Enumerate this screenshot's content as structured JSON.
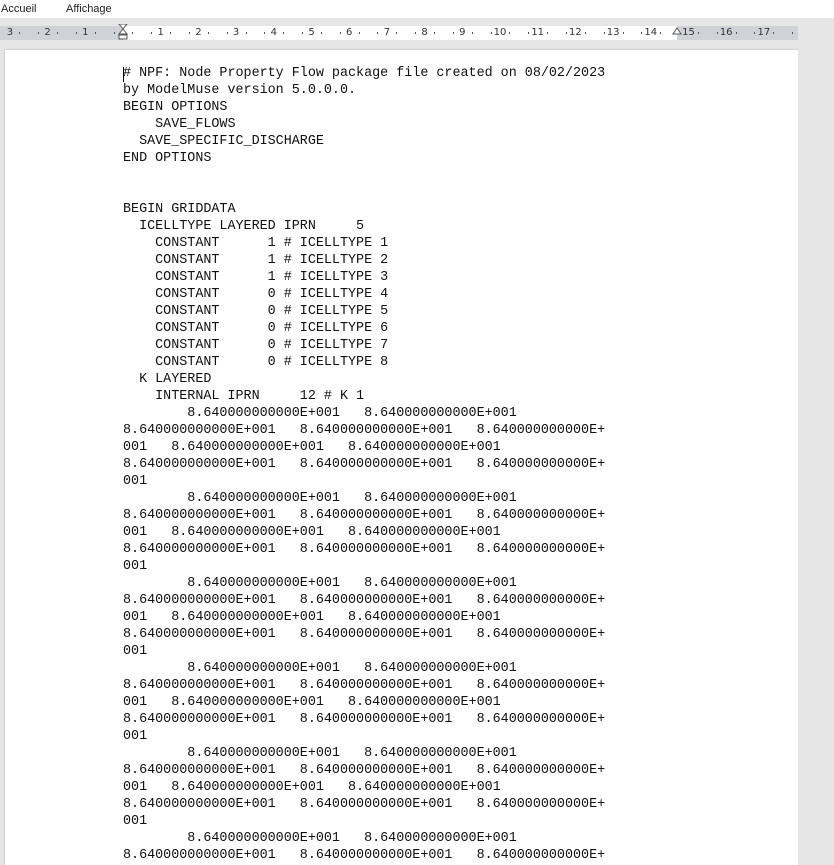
{
  "menu": {
    "tabs": [
      "Accueil",
      "Affichage"
    ]
  },
  "ruler": {
    "labels": [
      "3",
      "2",
      "1",
      "1",
      "2",
      "3",
      "4",
      "5",
      "6",
      "7",
      "8",
      "9",
      "10",
      "11",
      "12",
      "13",
      "14",
      "15",
      "16",
      "17"
    ]
  },
  "document": {
    "lines": [
      "# NPF: Node Property Flow package file created on 08/02/2023",
      "by ModelMuse version 5.0.0.0.",
      "BEGIN OPTIONS",
      "    SAVE_FLOWS",
      "  SAVE_SPECIFIC_DISCHARGE",
      "END OPTIONS",
      "",
      "",
      "BEGIN GRIDDATA",
      "  ICELLTYPE LAYERED IPRN     5",
      "    CONSTANT      1 # ICELLTYPE 1",
      "    CONSTANT      1 # ICELLTYPE 2",
      "    CONSTANT      1 # ICELLTYPE 3",
      "    CONSTANT      0 # ICELLTYPE 4",
      "    CONSTANT      0 # ICELLTYPE 5",
      "    CONSTANT      0 # ICELLTYPE 6",
      "    CONSTANT      0 # ICELLTYPE 7",
      "    CONSTANT      0 # ICELLTYPE 8",
      "  K LAYERED",
      "    INTERNAL IPRN     12 # K 1",
      "        8.640000000000E+001   8.640000000000E+001",
      "8.640000000000E+001   8.640000000000E+001   8.640000000000E+",
      "001   8.640000000000E+001   8.640000000000E+001",
      "8.640000000000E+001   8.640000000000E+001   8.640000000000E+",
      "001",
      "        8.640000000000E+001   8.640000000000E+001",
      "8.640000000000E+001   8.640000000000E+001   8.640000000000E+",
      "001   8.640000000000E+001   8.640000000000E+001",
      "8.640000000000E+001   8.640000000000E+001   8.640000000000E+",
      "001",
      "        8.640000000000E+001   8.640000000000E+001",
      "8.640000000000E+001   8.640000000000E+001   8.640000000000E+",
      "001   8.640000000000E+001   8.640000000000E+001",
      "8.640000000000E+001   8.640000000000E+001   8.640000000000E+",
      "001",
      "        8.640000000000E+001   8.640000000000E+001",
      "8.640000000000E+001   8.640000000000E+001   8.640000000000E+",
      "001   8.640000000000E+001   8.640000000000E+001",
      "8.640000000000E+001   8.640000000000E+001   8.640000000000E+",
      "001",
      "        8.640000000000E+001   8.640000000000E+001",
      "8.640000000000E+001   8.640000000000E+001   8.640000000000E+",
      "001   8.640000000000E+001   8.640000000000E+001",
      "8.640000000000E+001   8.640000000000E+001   8.640000000000E+",
      "001",
      "        8.640000000000E+001   8.640000000000E+001",
      "8.640000000000E+001   8.640000000000E+001   8.640000000000E+"
    ]
  }
}
